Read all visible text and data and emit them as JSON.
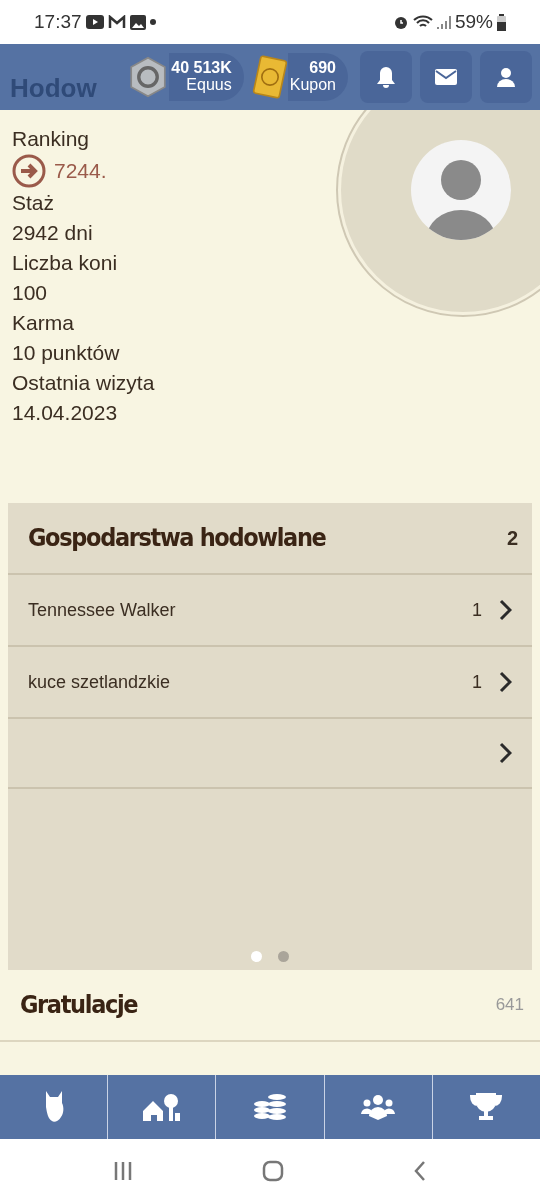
{
  "status_bar": {
    "time": "17:37",
    "battery": "59%"
  },
  "header": {
    "title": "Hodow",
    "currencies": [
      {
        "kind": "equus",
        "value": "40 513K",
        "label": "Equus"
      },
      {
        "kind": "kupon",
        "value": "690",
        "label": "Kupon"
      }
    ]
  },
  "profile": [
    {
      "kind": "rank",
      "label": "Ranking",
      "value": "7244."
    },
    {
      "kind": "plain",
      "label": "Staż",
      "value": "2942 dni"
    },
    {
      "kind": "plain",
      "label": "Liczba koni",
      "value": "100"
    },
    {
      "kind": "plain",
      "label": "Karma",
      "value": "10 punktów"
    },
    {
      "kind": "plain",
      "label": "Ostatnia wizyta",
      "value": "14.04.2023"
    }
  ],
  "farms": {
    "title": "Gospodarstwa hodowlane",
    "count": "2",
    "rows": [
      {
        "kind": "farm",
        "name": "Tennessee Walker",
        "count": "1"
      },
      {
        "kind": "farm",
        "name": "kuce szetlandzkie",
        "count": "1"
      },
      {
        "kind": "more"
      }
    ],
    "pager": [
      {
        "selected": true
      },
      {
        "selected": false
      }
    ]
  },
  "congratulations": {
    "title": "Gratulacje",
    "count": "641"
  }
}
